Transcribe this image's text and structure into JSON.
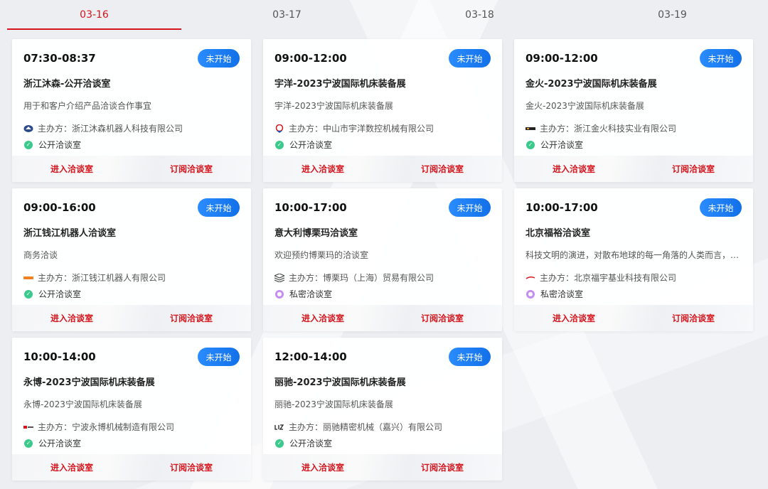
{
  "tabs": [
    {
      "label": "03-16",
      "active": true
    },
    {
      "label": "03-17",
      "active": false
    },
    {
      "label": "03-18",
      "active": false
    },
    {
      "label": "03-19",
      "active": false
    }
  ],
  "labels": {
    "organizer_prefix": "主办方：",
    "enter": "进入洽谈室",
    "subscribe": "订阅洽谈室"
  },
  "cards": [
    {
      "time": "07:30-08:37",
      "status": "未开始",
      "title": "浙江沐森-公开洽谈室",
      "desc": "用于和客户介绍产品洽谈合作事宜",
      "organizer": "浙江沐森机器人科技有限公司",
      "room_type": "公开洽谈室",
      "room_kind": "public",
      "logo": "mushen-logo"
    },
    {
      "time": "09:00-12:00",
      "status": "未开始",
      "title": "宇洋-2023宁波国际机床装备展",
      "desc": "宇洋-2023宁波国际机床装备展",
      "organizer": "中山市宇洋数控机械有限公司",
      "room_type": "公开洽谈室",
      "room_kind": "public",
      "logo": "yuyang-logo"
    },
    {
      "time": "09:00-12:00",
      "status": "未开始",
      "title": "金火-2023宁波国际机床装备展",
      "desc": "金火-2023宁波国际机床装备展",
      "organizer": "浙江金火科技实业有限公司",
      "room_type": "公开洽谈室",
      "room_kind": "public",
      "logo": "jinhuo-logo"
    },
    {
      "time": "09:00-16:00",
      "status": "未开始",
      "title": "浙江钱江机器人洽谈室",
      "desc": "商务洽谈",
      "organizer": "浙江钱江机器人有限公司",
      "room_type": "公开洽谈室",
      "room_kind": "public",
      "logo": "qianjiang-logo"
    },
    {
      "time": "10:00-17:00",
      "status": "未开始",
      "title": "意大利博栗玛洽谈室",
      "desc": "欢迎预约博栗玛的洽谈室",
      "organizer": "博栗玛（上海）贸易有限公司",
      "room_type": "私密洽谈室",
      "room_kind": "private",
      "logo": "bolima-logo"
    },
    {
      "time": "10:00-17:00",
      "status": "未开始",
      "title": "北京福裕洽谈室",
      "desc": "科技文明的演进，对散布地球的每一角落的人类而言，距离和空间的限制正在消失",
      "organizer": "北京福宇基业科技有限公司",
      "room_type": "私密洽谈室",
      "room_kind": "private",
      "logo": "fuyu-logo"
    },
    {
      "time": "10:00-14:00",
      "status": "未开始",
      "title": "永博-2023宁波国际机床装备展",
      "desc": "永博-2023宁波国际机床装备展",
      "organizer": "宁波永博机械制造有限公司",
      "room_type": "公开洽谈室",
      "room_kind": "public",
      "logo": "yongbo-logo"
    },
    {
      "time": "12:00-14:00",
      "status": "未开始",
      "title": "丽驰-2023宁波国际机床装备展",
      "desc": "丽驰-2023宁波国际机床装备展",
      "organizer": "丽驰精密机械（嘉兴）有限公司",
      "room_type": "公开洽谈室",
      "room_kind": "public",
      "logo": "lichi-logo"
    }
  ]
}
